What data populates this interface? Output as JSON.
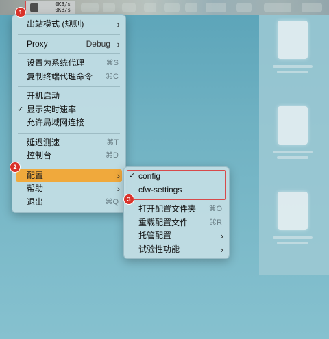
{
  "status": {
    "upload": "0KB/s",
    "download": "0KB/s"
  },
  "badges": [
    "1",
    "2",
    "3"
  ],
  "main_menu": {
    "outbound_mode": "出站模式 (规则)",
    "proxy_label": "Proxy",
    "proxy_value": "Debug",
    "set_system_proxy": "设置为系统代理",
    "set_system_proxy_shortcut": "⌘S",
    "copy_terminal_cmd": "复制终端代理命令",
    "copy_terminal_cmd_shortcut": "⌘C",
    "start_at_login": "开机启动",
    "show_speed": "显示实时速率",
    "show_speed_checked": true,
    "allow_lan": "允许局域网连接",
    "latency_test": "延迟测速",
    "latency_test_shortcut": "⌘T",
    "dashboard": "控制台",
    "dashboard_shortcut": "⌘D",
    "config": "配置",
    "help": "帮助",
    "quit": "退出",
    "quit_shortcut": "⌘Q"
  },
  "config_menu": {
    "configs": [
      {
        "name": "config",
        "checked": true
      },
      {
        "name": "cfw-settings",
        "checked": false
      }
    ],
    "open_config_folder": "打开配置文件夹",
    "open_config_folder_shortcut": "⌘O",
    "reload_config": "重载配置文件",
    "reload_config_shortcut": "⌘R",
    "managed_config": "托管配置",
    "experimental": "试验性功能"
  },
  "glyphs": {
    "check": "✓",
    "chevron": "›"
  }
}
